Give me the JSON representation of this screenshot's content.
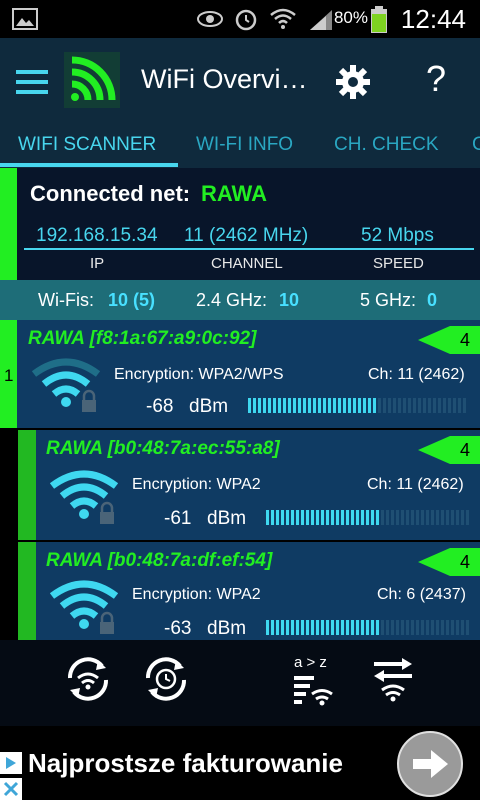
{
  "status_bar": {
    "battery": "80%",
    "time": "12:44"
  },
  "app_bar": {
    "title": "WiFi Overvi…",
    "menu_icon": "menu-icon",
    "settings_icon": "gear-icon",
    "help_label": "?"
  },
  "tabs": [
    {
      "label": "WIFI SCANNER",
      "active": true
    },
    {
      "label": "WI-FI INFO",
      "active": false
    },
    {
      "label": "CH. CHECK",
      "active": false
    },
    {
      "label": "C",
      "active": false
    }
  ],
  "connected": {
    "label": "Connected net:",
    "ssid": "RAWA",
    "ip": "192.168.15.34",
    "channel": "11 (2462 MHz)",
    "speed": "52 Mbps",
    "ip_caption": "IP",
    "channel_caption": "CHANNEL",
    "speed_caption": "SPEED"
  },
  "counts": {
    "wifis_label": "Wi-Fis:",
    "wifis_value": "10 (5)",
    "ghz24_label": "2.4 GHz:",
    "ghz24_value": "10",
    "ghz5_label": "5 GHz:",
    "ghz5_value": "0"
  },
  "networks": [
    {
      "ssid": "RAWA [f8:1a:67:a9:0c:92]",
      "encryption": "Encryption: WPA2/WPS",
      "channel": "Ch: 11 (2462)",
      "dbm": "-68",
      "unit": "dBm",
      "signal_level": 0.58,
      "badge": "4",
      "index": "1"
    },
    {
      "ssid": "RAWA [b0:48:7a:ec:55:a8]",
      "encryption": "Encryption: WPA2",
      "channel": "Ch: 11 (2462)",
      "dbm": "-61",
      "unit": "dBm",
      "signal_level": 0.55,
      "badge": "4"
    },
    {
      "ssid": "RAWA [b0:48:7a:df:ef:54]",
      "encryption": "Encryption: WPA2",
      "channel": "Ch: 6 (2437)",
      "dbm": "-63",
      "unit": "dBm",
      "signal_level": 0.55,
      "badge": "4"
    }
  ],
  "toolbar": {
    "sort_label": "a > z"
  },
  "ad": {
    "text": "Najprostsze fakturowanie"
  },
  "colors": {
    "accent_green": "#22ee22",
    "accent_cyan": "#48d6ee",
    "card_blue": "#0f3b63"
  }
}
